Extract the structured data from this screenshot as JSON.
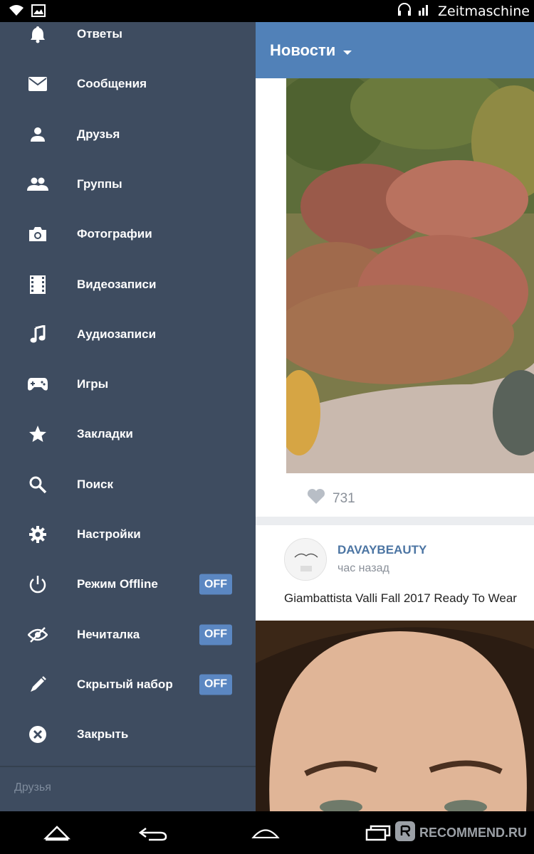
{
  "status_bar": {
    "watermark": "Zeitmaschine",
    "icons": [
      "wifi-icon",
      "gallery-icon",
      "headphones-icon",
      "signal-icon"
    ]
  },
  "sidebar": {
    "items": [
      {
        "label": "Ответы",
        "icon": "bell-icon"
      },
      {
        "label": "Сообщения",
        "icon": "envelope-icon"
      },
      {
        "label": "Друзья",
        "icon": "person-icon"
      },
      {
        "label": "Группы",
        "icon": "group-icon"
      },
      {
        "label": "Фотографии",
        "icon": "camera-icon"
      },
      {
        "label": "Видеозаписи",
        "icon": "film-icon"
      },
      {
        "label": "Аудиозаписи",
        "icon": "music-note-icon"
      },
      {
        "label": "Игры",
        "icon": "gamepad-icon"
      },
      {
        "label": "Закладки",
        "icon": "star-icon"
      },
      {
        "label": "Поиск",
        "icon": "search-icon"
      },
      {
        "label": "Настройки",
        "icon": "gear-icon"
      },
      {
        "label": "Режим Offline",
        "icon": "power-icon",
        "toggle": "OFF"
      },
      {
        "label": "Нечиталка",
        "icon": "eye-off-icon",
        "toggle": "OFF"
      },
      {
        "label": "Скрытый набор",
        "icon": "pen-icon",
        "toggle": "OFF"
      },
      {
        "label": "Закрыть",
        "icon": "close-circle-icon"
      }
    ],
    "footer": "Друзья"
  },
  "header": {
    "title": "Новости"
  },
  "feed": {
    "post1": {
      "likes": "731"
    },
    "post2": {
      "author": "DAVAYBEAUTY",
      "time": "час назад",
      "text": "Giambattista Valli Fall 2017 Ready To Wear"
    }
  },
  "nav": {
    "watermark": "RECOMMEND.RU"
  },
  "colors": {
    "sidebar_bg": "#3e4c60",
    "header_bg": "#5181b8",
    "toggle_bg": "#5b87c2",
    "author_link": "#4c75a3"
  }
}
